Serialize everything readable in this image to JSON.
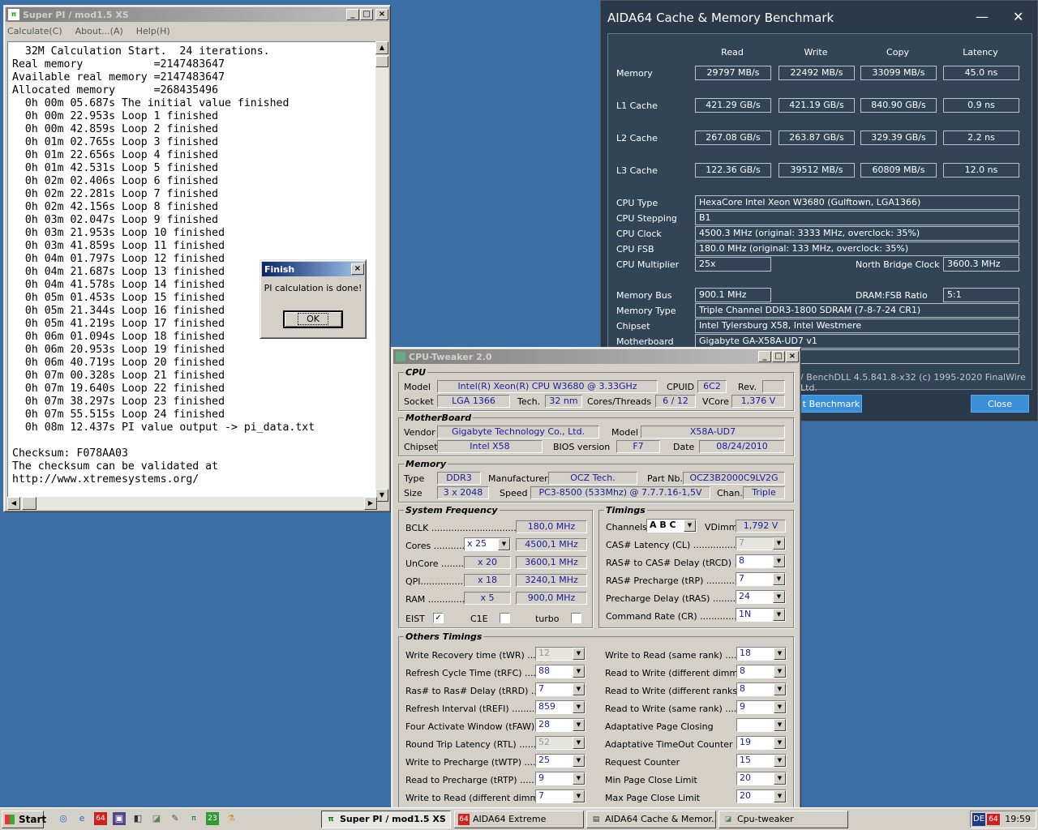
{
  "superpi": {
    "title": "Super PI / mod1.5 XS",
    "menu": [
      "Calculate(C)",
      "About...(A)",
      "Help(H)"
    ],
    "lines": [
      "  32M Calculation Start.  24 iterations.",
      "Real memory           =2147483647",
      "Available real memory =2147483647",
      "Allocated memory      =268435496",
      "  0h 00m 05.687s The initial value finished",
      "  0h 00m 22.953s Loop 1 finished",
      "  0h 00m 42.859s Loop 2 finished",
      "  0h 01m 02.765s Loop 3 finished",
      "  0h 01m 22.656s Loop 4 finished",
      "  0h 01m 42.531s Loop 5 finished",
      "  0h 02m 02.406s Loop 6 finished",
      "  0h 02m 22.281s Loop 7 finished",
      "  0h 02m 42.156s Loop 8 finished",
      "  0h 03m 02.047s Loop 9 finished",
      "  0h 03m 21.953s Loop 10 finished",
      "  0h 03m 41.859s Loop 11 finished",
      "  0h 04m 01.797s Loop 12 finished",
      "  0h 04m 21.687s Loop 13 finished",
      "  0h 04m 41.578s Loop 14 finished",
      "  0h 05m 01.453s Loop 15 finished",
      "  0h 05m 21.344s Loop 16 finished",
      "  0h 05m 41.219s Loop 17 finished",
      "  0h 06m 01.094s Loop 18 finished",
      "  0h 06m 20.953s Loop 19 finished",
      "  0h 06m 40.719s Loop 20 finished",
      "  0h 07m 00.328s Loop 21 finished",
      "  0h 07m 19.640s Loop 22 finished",
      "  0h 07m 38.297s Loop 23 finished",
      "  0h 07m 55.515s Loop 24 finished",
      "  0h 08m 12.437s PI value output -> pi_data.txt",
      "",
      "Checksum: F078AA03",
      "The checksum can be validated at",
      "http://www.xtremesystems.org/"
    ]
  },
  "finish_dialog": {
    "title": "Finish",
    "message": "PI calculation is done!",
    "ok": "OK"
  },
  "aida": {
    "title": "AIDA64 Cache & Memory Benchmark",
    "headers": [
      "Read",
      "Write",
      "Copy",
      "Latency"
    ],
    "rows": [
      {
        "label": "Memory",
        "values": [
          "29797 MB/s",
          "22492 MB/s",
          "33099 MB/s",
          "45.0 ns"
        ]
      },
      {
        "label": "L1 Cache",
        "values": [
          "421.29 GB/s",
          "421.19 GB/s",
          "840.90 GB/s",
          "0.9 ns"
        ]
      },
      {
        "label": "L2 Cache",
        "values": [
          "267.08 GB/s",
          "263.87 GB/s",
          "329.39 GB/s",
          "2.2 ns"
        ]
      },
      {
        "label": "L3 Cache",
        "values": [
          "122.36 GB/s",
          "39512 MB/s",
          "60809 MB/s",
          "12.0 ns"
        ]
      }
    ],
    "cpu_type_l": "CPU Type",
    "cpu_type": "HexaCore Intel Xeon W3680  (Gulftown, LGA1366)",
    "cpu_stepping_l": "CPU Stepping",
    "cpu_stepping": "B1",
    "cpu_clock_l": "CPU Clock",
    "cpu_clock": "4500.3 MHz  (original: 3333 MHz, overclock: 35%)",
    "cpu_fsb_l": "CPU FSB",
    "cpu_fsb": "180.0 MHz  (original: 133 MHz, overclock: 35%)",
    "cpu_mult_l": "CPU Multiplier",
    "cpu_mult": "25x",
    "nb_clock_l": "North Bridge Clock",
    "nb_clock": "3600.3 MHz",
    "mem_bus_l": "Memory Bus",
    "mem_bus": "900.1 MHz",
    "dram_fsb_l": "DRAM:FSB Ratio",
    "dram_fsb": "5:1",
    "mem_type_l": "Memory Type",
    "mem_type": "Triple Channel DDR3-1800 SDRAM  (7-8-7-24 CR1)",
    "chipset_l": "Chipset",
    "chipset": "Intel Tylersburg X58, Intel Westmere",
    "motherboard_l": "Motherboard",
    "motherboard": "Gigabyte GA-X58A-UD7 v1",
    "footer": "/ BenchDLL 4.5.841.8-x32  (c) 1995-2020 FinalWire Ltd.",
    "start_btn": "t Benchmark",
    "close_btn": "Close"
  },
  "cpu_tweaker": {
    "title": "CPU-Tweaker 2.0",
    "cpu": {
      "group": "CPU",
      "model_l": "Model",
      "model": "Intel(R) Xeon(R) CPU        W3680  @ 3.33GHz",
      "cpuid_l": "CPUID",
      "cpuid": "6C2",
      "rev_l": "Rev.",
      "rev": "",
      "socket_l": "Socket",
      "socket": "LGA 1366",
      "tech_l": "Tech.",
      "tech": "32 nm",
      "cores_l": "Cores/Threads",
      "cores": "6 / 12",
      "vcore_l": "VCore",
      "vcore": "1,376 V"
    },
    "mb": {
      "group": "MotherBoard",
      "vendor_l": "Vendor",
      "vendor": "Gigabyte Technology Co., Ltd.",
      "model_l": "Model",
      "model": "X58A-UD7",
      "chipset_l": "Chipset",
      "chipset": "Intel X58",
      "bios_l": "BIOS version",
      "bios": "F7",
      "date_l": "Date",
      "date": "08/24/2010"
    },
    "mem": {
      "group": "Memory",
      "type_l": "Type",
      "type": "DDR3",
      "manuf_l": "Manufacturer",
      "manuf": "OCZ Tech.",
      "part_l": "Part Nb.",
      "part": "OCZ3B2000C9LV2G",
      "size_l": "Size",
      "size": "3 x 2048",
      "speed_l": "Speed",
      "speed": "PC3-8500 (533Mhz) @ 7.7.7.16-1,5V",
      "chan_l": "Chan.",
      "chan": "Triple"
    },
    "sysfreq": {
      "group": "System Frequency",
      "bclk_l": "BCLK ..................................",
      "bclk": "180,0 MHz",
      "cores_l": "Cores ..............",
      "cores_mult": "x 25",
      "cores": "4500,1 MHz",
      "uncore_l": "UnCore ...........",
      "uncore_mult": "x 20",
      "uncore": "3600,1 MHz",
      "qpi_l": "QPI...............",
      "qpi_mult": "x 18",
      "qpi": "3240,1 MHz",
      "ram_l": "RAM ...............",
      "ram_mult": "x 5",
      "ram": "900,0 MHz",
      "eist": "EIST",
      "c1e": "C1E",
      "turbo": "turbo"
    },
    "timings": {
      "group": "Timings",
      "channels_l": "Channels",
      "channels": "A B C",
      "vdimm_l": "VDimm",
      "vdimm": "1,792 V",
      "cl_l": "CAS# Latency (CL) ......................",
      "cl": "7",
      "trcd_l": "RAS# to CAS# Delay (tRCD) ........",
      "trcd": "8",
      "trp_l": "RAS# Precharge (tRP) .................",
      "trp": "7",
      "tras_l": "Precharge Delay (tRAS) ..............",
      "tras": "24",
      "cr_l": "Command Rate (CR) ..................",
      "cr": "1N"
    },
    "others": {
      "group": "Others Timings",
      "left": [
        {
          "label": "Write Recovery time (tWR) ...........",
          "value": "12",
          "dis": true
        },
        {
          "label": "Refresh Cycle Time (tRFC) ............",
          "value": "88"
        },
        {
          "label": "Ras# to Ras# Delay (tRRD) ............",
          "value": "7"
        },
        {
          "label": "Refresh Interval (tREFI) ..................",
          "value": "859"
        },
        {
          "label": "Four Activate Window (tFAW) ....",
          "value": "28"
        },
        {
          "label": "Round Trip Latency (RTL) ...........",
          "value": "52",
          "dis": true
        },
        {
          "label": "Write to Precharge (tWTP) ..........",
          "value": "25"
        },
        {
          "label": "Read to Precharge (tRTP) ............",
          "value": "9"
        },
        {
          "label": "Write to Read (different dimms) ...",
          "value": "7"
        }
      ],
      "right": [
        {
          "label": "Write to Read (same rank) ...........",
          "value": "18"
        },
        {
          "label": "Read to Write (different dimms) ...",
          "value": "8"
        },
        {
          "label": "Read to Write (different ranks) ....",
          "value": "8"
        },
        {
          "label": "Read to Write (same rank) ............",
          "value": "9"
        },
        {
          "label": "Adaptative Page Closing",
          "value": ""
        },
        {
          "label": "Adaptative TimeOut Counter",
          "value": "19"
        },
        {
          "label": "Request Counter",
          "value": "15"
        },
        {
          "label": "Min Page Close Limit",
          "value": "20"
        },
        {
          "label": "Max Page Close Limit",
          "value": "20"
        }
      ]
    }
  },
  "taskbar": {
    "start": "Start",
    "tasks": [
      "Super PI / mod1.5 XS",
      "AIDA64 Extreme",
      "AIDA64 Cache & Memor...",
      "Cpu-tweaker"
    ],
    "lang": "DE",
    "clock": "19:59"
  }
}
